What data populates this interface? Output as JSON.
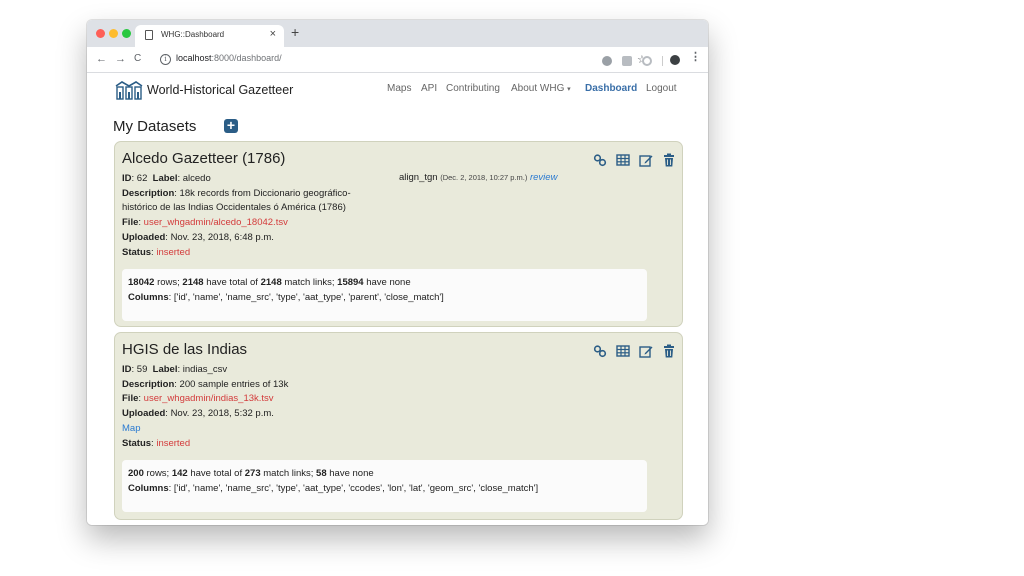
{
  "browser": {
    "tab_title": "WHG::Dashboard",
    "tab_close": "×",
    "new_tab": "+",
    "url_host": "localhost",
    "url_rest": ":8000/dashboard/",
    "back": "←",
    "forward": "→",
    "reload": "C",
    "star": "☆",
    "info": "i",
    "menu": "⋮"
  },
  "site": {
    "brand": "World-Historical Gazetteer",
    "nav": {
      "maps": "Maps",
      "api": "API",
      "contributing": "Contributing",
      "about": "About WHG",
      "dashboard": "Dashboard",
      "logout": "Logout"
    },
    "heading": "My Datasets",
    "add": "+"
  },
  "labels": {
    "id": "ID",
    "label": "Label",
    "description": "Description",
    "file": "File",
    "uploaded": "Uploaded",
    "status": "Status",
    "rows_text": "rows;",
    "have_total_of": "have total of",
    "match_links": "match links;",
    "have_none": "have none",
    "columns": "Columns"
  },
  "datasets": [
    {
      "title": "Alcedo Gazetteer (1786)",
      "id": "62",
      "label": "alcedo",
      "description_1": "18k records from Diccionario geográfico-",
      "description_2": "histórico de las Indias Occidentales ó América (1786)",
      "file": "user_whgadmin/alcedo_18042.tsv",
      "uploaded": "Nov. 23, 2018, 6:48 p.m.",
      "status": "inserted",
      "align_task": "align_tgn",
      "align_date": "(Dec. 2, 2018, 10:27 p.m.)",
      "align_review": "review",
      "rows": "18042",
      "matched": "2148",
      "links": "2148",
      "none": "15894",
      "columns": "['id', 'name', 'name_src', 'type', 'aat_type', 'parent', 'close_match']"
    },
    {
      "title": "HGIS de las Indias",
      "id": "59",
      "label": "indias_csv",
      "description": "200 sample entries of 13k",
      "file": "user_whgadmin/indias_13k.tsv",
      "uploaded": "Nov. 23, 2018, 5:32 p.m.",
      "map_link": "Map",
      "status": "inserted",
      "rows": "200",
      "matched": "142",
      "links": "273",
      "none": "58",
      "columns": "['id', 'name', 'name_src', 'type', 'aat_type', 'ccodes', 'lon', 'lat', 'geom_src', 'close_match']"
    }
  ],
  "colors": {
    "card_bg": "#e9eadb",
    "icon_blue": "#2b5d86",
    "link_blue": "#2a7ad1",
    "status_red": "#d33b3b",
    "nav_active": "#3a6fa8"
  },
  "icons": [
    "link-icon",
    "table-icon",
    "edit-icon",
    "trash-icon",
    "plus-icon"
  ]
}
